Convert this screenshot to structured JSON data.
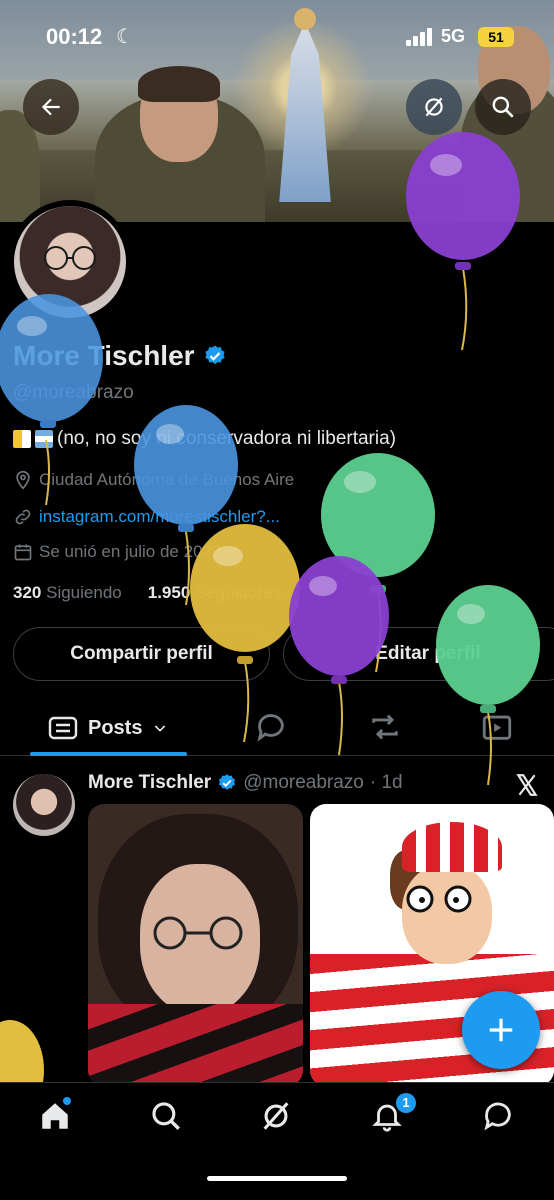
{
  "status_bar": {
    "time": "00:12",
    "network": "5G",
    "battery": "51"
  },
  "profile": {
    "name": "More Tischler",
    "handle": "@moreabrazo",
    "bio": "(no, no soy ni conservadora ni libertaria)",
    "location": "Ciudad Autónoma de Buenos Aire",
    "link": "instagram.com/morestischler?...",
    "joined": "Se unió en julio de 2023",
    "following_count": "320",
    "following_label": "Siguiendo",
    "followers_count": "1.950",
    "followers_label": "Seguidores"
  },
  "actions": {
    "share": "Compartir perfil",
    "edit": "Editar perfil"
  },
  "tabs": {
    "active": "Posts"
  },
  "post": {
    "author": "More Tischler",
    "handle": "@moreabrazo",
    "time": "· 1d"
  },
  "notifications_badge": "1",
  "colors": {
    "accent": "#1d9bf0",
    "balloon_purple": "#8a3fd1",
    "balloon_blue": "#4a95e0",
    "balloon_green": "#5ccf8f",
    "balloon_yellow": "#e3bd3f"
  },
  "icons": [
    "back-arrow-icon",
    "grok-icon",
    "search-icon",
    "verified-badge-icon",
    "location-icon",
    "link-icon",
    "calendar-icon",
    "chevron-down-icon",
    "reply-icon",
    "repost-icon",
    "media-icon",
    "x-logo-icon",
    "plus-icon",
    "home-icon",
    "notifications-icon",
    "messages-icon"
  ]
}
